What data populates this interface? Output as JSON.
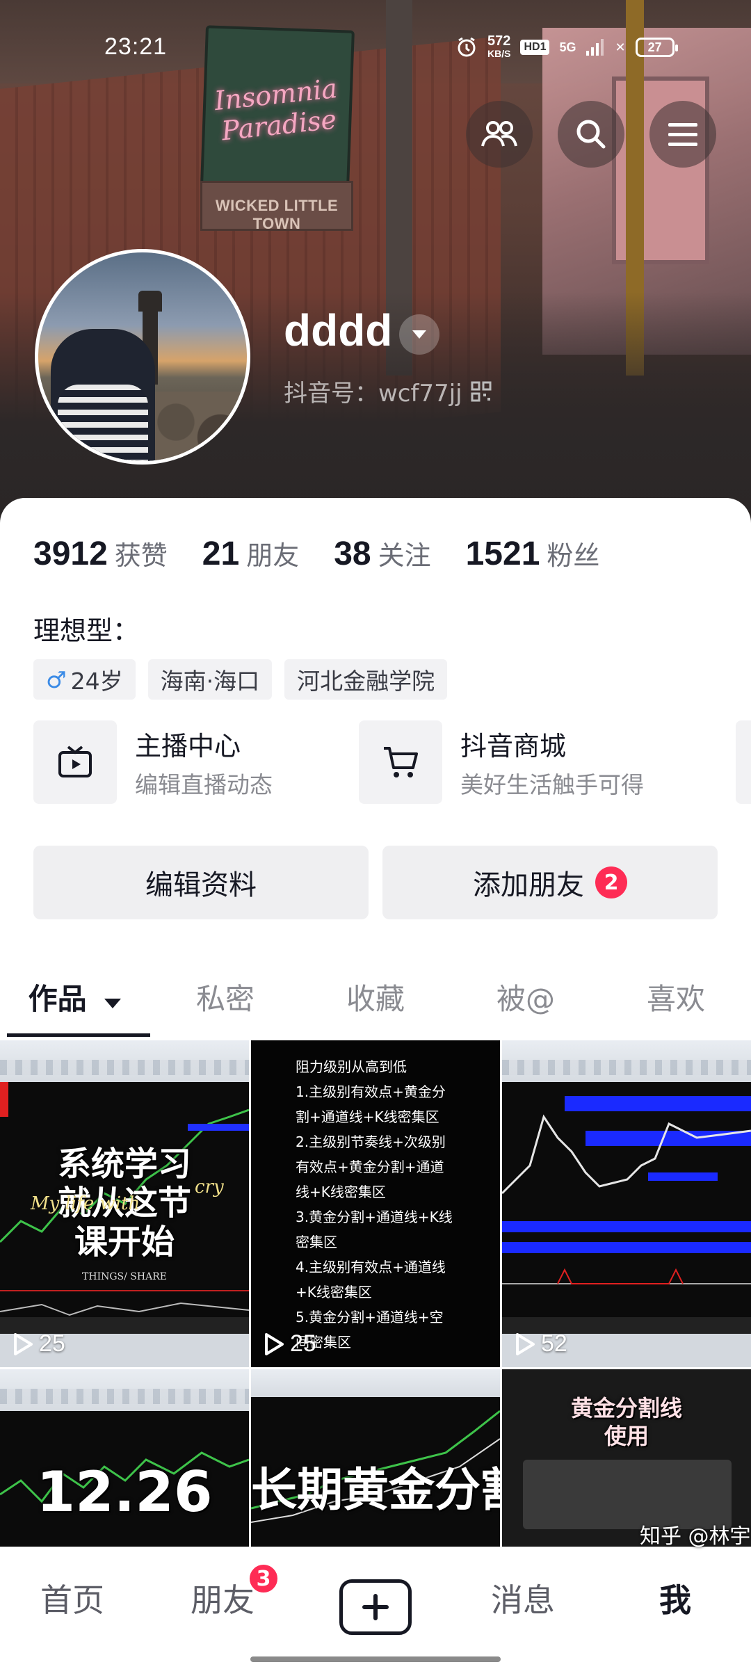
{
  "status_bar": {
    "time": "23:21",
    "net_speed": "572",
    "net_unit": "KB/S",
    "hd_label": "HD1",
    "network": "5G",
    "battery": "27"
  },
  "cover": {
    "sign_text": "Insomnia Paradise",
    "town_text": "WICKED LITTLE TOWN"
  },
  "profile": {
    "username": "dddd",
    "douyin_id": "抖音号：wcf77jj",
    "stats": [
      {
        "value": "3912",
        "label": "获赞"
      },
      {
        "value": "21",
        "label": "朋友"
      },
      {
        "value": "38",
        "label": "关注"
      },
      {
        "value": "1521",
        "label": "粉丝"
      }
    ],
    "bio": "理想型：",
    "tags": [
      {
        "icon": "male-icon",
        "text": "24岁"
      },
      {
        "text": "海南·海口"
      },
      {
        "text": "河北金融学院"
      }
    ]
  },
  "services": [
    {
      "title": "主播中心",
      "subtitle": "编辑直播动态",
      "icon": "tv-icon"
    },
    {
      "title": "抖音商城",
      "subtitle": "美好生活触手可得",
      "icon": "cart-icon"
    }
  ],
  "actions": {
    "edit_profile": "编辑资料",
    "add_friend": "添加朋友",
    "add_friend_badge": "2"
  },
  "tabs": [
    "作品",
    "私密",
    "收藏",
    "被@",
    "喜欢"
  ],
  "videos": [
    {
      "plays": "25",
      "title_lines": [
        "系统学习",
        "就从这节",
        "课开始"
      ],
      "watermark": "My life with",
      "watermark2": "cry",
      "footer_tag": "THINGS/ SHARE"
    },
    {
      "plays": "25",
      "lines": [
        "阻力级别从高到低",
        "1.主级别有效点+黄金分",
        "割+通道线+K线密集区",
        "2.主级别节奏线+次级别",
        "有效点+黄金分割+通道",
        "线+K线密集区",
        "3.黄金分割+通道线+K线",
        "密集区",
        "4.主级别有效点+通道线",
        "+K线密集区",
        "5.黄金分割+通道线+空",
        "间密集区"
      ]
    },
    {
      "plays": "52"
    },
    {
      "title": "12.26"
    },
    {
      "title": "长期黄金分割"
    },
    {
      "title_lines": [
        "黄金分割线",
        "使用"
      ]
    }
  ],
  "bottom_nav": {
    "home": "首页",
    "friends": "朋友",
    "friends_badge": "3",
    "messages": "消息",
    "me": "我",
    "watermark": "知乎 @林宇"
  }
}
